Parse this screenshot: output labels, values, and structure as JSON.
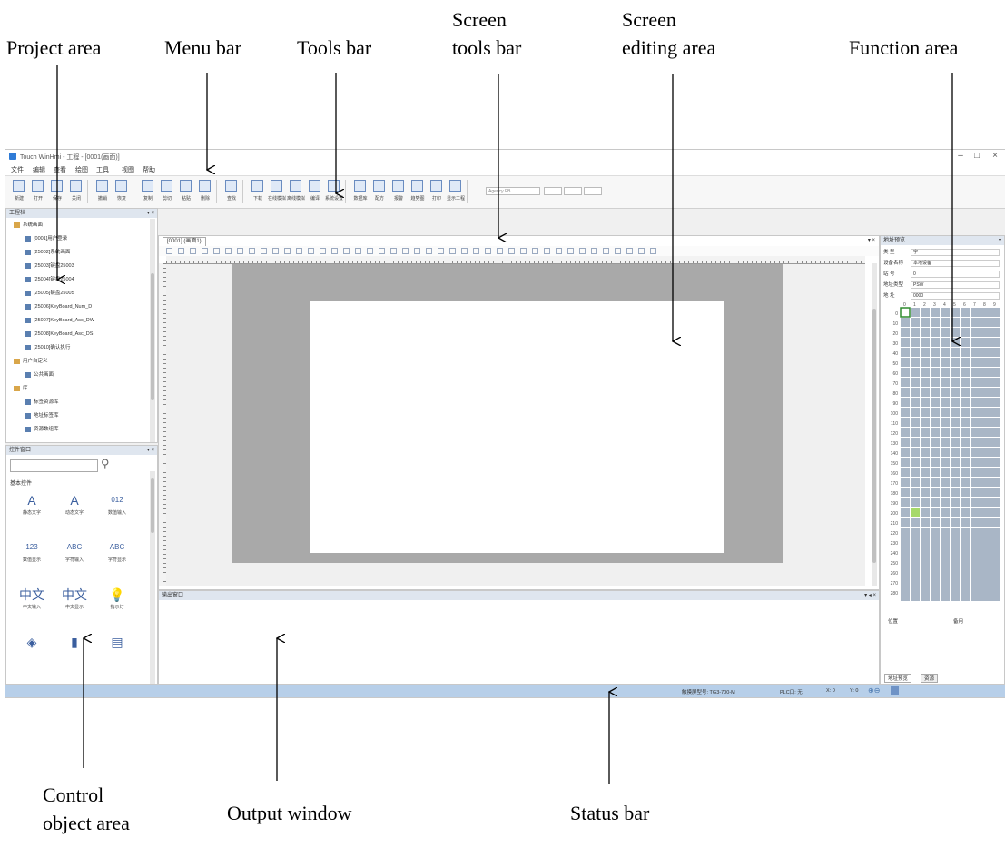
{
  "annotations": {
    "project_area": "Project area",
    "menu_bar": "Menu bar",
    "tools_bar": "Tools bar",
    "screen_tools_bar": [
      "Screen",
      "tools bar"
    ],
    "screen_editing_area": [
      "Screen",
      "editing area"
    ],
    "function_area": "Function area",
    "control_object_area": [
      "Control",
      "object area"
    ],
    "output_window": "Output window",
    "status_bar": "Status bar"
  },
  "window": {
    "title": "Touch WinHmi - 工程 - [0001(画面)]",
    "controls": [
      "–",
      "□",
      "×"
    ]
  },
  "menu": [
    "文件",
    "编辑",
    "查看",
    "绘图",
    "工具",
    "视图",
    "帮助"
  ],
  "toolbar": [
    {
      "label": "新建",
      "icon": "new-file-icon"
    },
    {
      "label": "打开",
      "icon": "open-folder-icon"
    },
    {
      "label": "保存",
      "icon": "save-icon"
    },
    {
      "label": "关闭",
      "icon": "close-file-icon"
    },
    {
      "label": "撤销",
      "icon": "undo-icon"
    },
    {
      "label": "恢复",
      "icon": "redo-icon"
    },
    {
      "label": "复制",
      "icon": "copy-icon"
    },
    {
      "label": "剪切",
      "icon": "cut-icon"
    },
    {
      "label": "粘贴",
      "icon": "paste-icon"
    },
    {
      "label": "删除",
      "icon": "delete-icon"
    },
    {
      "label": "查找",
      "icon": "find-icon"
    },
    {
      "label": "下载",
      "icon": "download-icon"
    },
    {
      "label": "在线模拟",
      "icon": "online-sim-icon"
    },
    {
      "label": "离线模拟",
      "icon": "offline-sim-icon"
    },
    {
      "label": "编译",
      "icon": "compile-icon"
    },
    {
      "label": "系统设置",
      "icon": "system-settings-icon"
    },
    {
      "label": "数据库",
      "icon": "database-icon"
    },
    {
      "label": "配方",
      "icon": "recipe-icon"
    },
    {
      "label": "报警",
      "icon": "alarm-icon"
    },
    {
      "label": "趋势图",
      "icon": "trend-icon"
    },
    {
      "label": "打印",
      "icon": "print-icon"
    },
    {
      "label": "显示工程",
      "icon": "show-project-icon"
    }
  ],
  "toolbar_font": "Agency FB",
  "project_panel": {
    "header": "工程栏",
    "items": [
      {
        "label": "系统画面",
        "level": 1,
        "folder": true
      },
      {
        "label": "[0001]用户登录",
        "level": 2
      },
      {
        "label": "[25002]系统画面",
        "level": 2
      },
      {
        "label": "[25003]键盘25003",
        "level": 2
      },
      {
        "label": "[25004]键盘25004",
        "level": 2
      },
      {
        "label": "[25005]键盘25005",
        "level": 2
      },
      {
        "label": "[25006]KeyBoard_Num_D",
        "level": 2
      },
      {
        "label": "[25007]KeyBoard_Asc_DW",
        "level": 2
      },
      {
        "label": "[25008]KeyBoard_Asc_DS",
        "level": 2
      },
      {
        "label": "[25010]确认执行",
        "level": 2
      },
      {
        "label": "用户自定义",
        "level": 1,
        "folder": true
      },
      {
        "label": "公共画面",
        "level": 2
      },
      {
        "label": "库",
        "level": 1,
        "folder": true
      },
      {
        "label": "标签资源库",
        "level": 2
      },
      {
        "label": "地址标签库",
        "level": 2
      },
      {
        "label": "资源数组库",
        "level": 2
      }
    ]
  },
  "control_panel": {
    "header": "控件窗口",
    "section": "基本控件",
    "items": [
      {
        "label": "静态文字",
        "glyph": "A"
      },
      {
        "label": "动态文字",
        "glyph": "A"
      },
      {
        "label": "数值输入",
        "glyph": "012"
      },
      {
        "label": "数值显示",
        "glyph": "123"
      },
      {
        "label": "字符输入",
        "glyph": "ABC"
      },
      {
        "label": "字符显示",
        "glyph": "ABC"
      },
      {
        "label": "中文输入",
        "glyph": "中文"
      },
      {
        "label": "中文显示",
        "glyph": "中文"
      },
      {
        "label": "指示灯",
        "glyph": "💡"
      },
      {
        "label": "",
        "glyph": "◈"
      },
      {
        "label": "",
        "glyph": "▮"
      },
      {
        "label": "",
        "glyph": "▤"
      }
    ]
  },
  "editor": {
    "tab_label": "[0001] (画面1)"
  },
  "output": {
    "header": "输出窗口"
  },
  "function_panel": {
    "header": "地址预览",
    "props": [
      {
        "label": "类 型",
        "value": "字"
      },
      {
        "label": "设备名称",
        "value": "本地设备"
      },
      {
        "label": "站 号",
        "value": "0"
      },
      {
        "label": "地址类型",
        "value": "PSW"
      },
      {
        "label": "地 址",
        "value": "0000"
      }
    ],
    "grid_cols": [
      "0",
      "1",
      "2",
      "3",
      "4",
      "5",
      "6",
      "7",
      "8",
      "9"
    ],
    "grid_rows": [
      "0",
      "10",
      "20",
      "30",
      "40",
      "50",
      "60",
      "70",
      "80",
      "90",
      "100",
      "110",
      "120",
      "130",
      "140",
      "150",
      "160",
      "170",
      "180",
      "190",
      "200",
      "210",
      "220",
      "230",
      "240",
      "250",
      "260",
      "270",
      "280",
      "290"
    ],
    "foot_labels": [
      "位置",
      "备用"
    ],
    "tabs": [
      "地址预览",
      "资源"
    ]
  },
  "statusbar": {
    "model": "触摸屏型号: TG3-700-M",
    "plc": "PLC口: 无",
    "x": "X: 0",
    "y": "Y: 0"
  }
}
